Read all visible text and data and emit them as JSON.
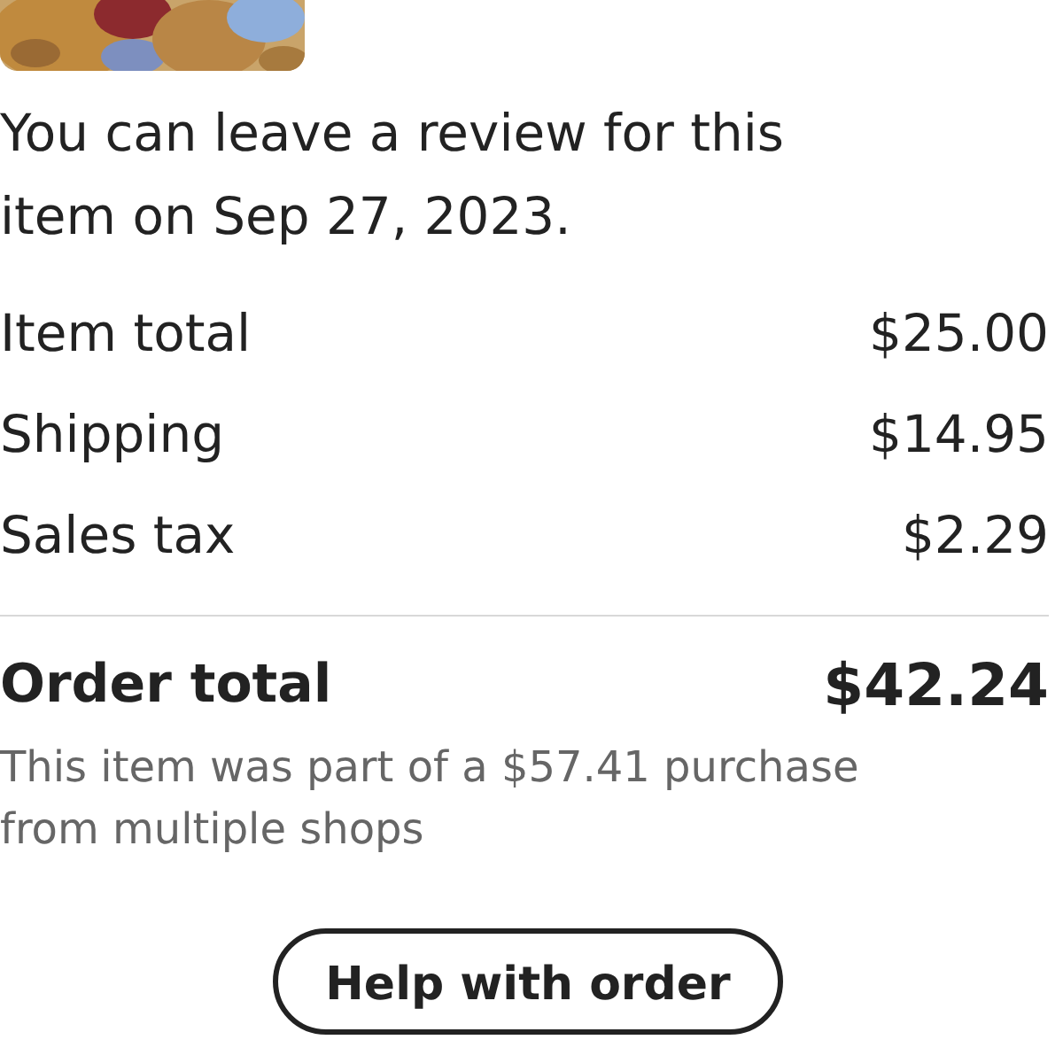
{
  "review_note": "You can leave a review for this item on Sep 27, 2023.",
  "summary": [
    {
      "label": "Item total",
      "value": "$25.00"
    },
    {
      "label": "Shipping",
      "value": "$14.95"
    },
    {
      "label": "Sales tax",
      "value": "$2.29"
    }
  ],
  "order_total": {
    "label": "Order total",
    "value": "$42.24"
  },
  "purchase_note": "This item was part of a $57.41 purchase from multiple shops",
  "help_button": "Help with order"
}
